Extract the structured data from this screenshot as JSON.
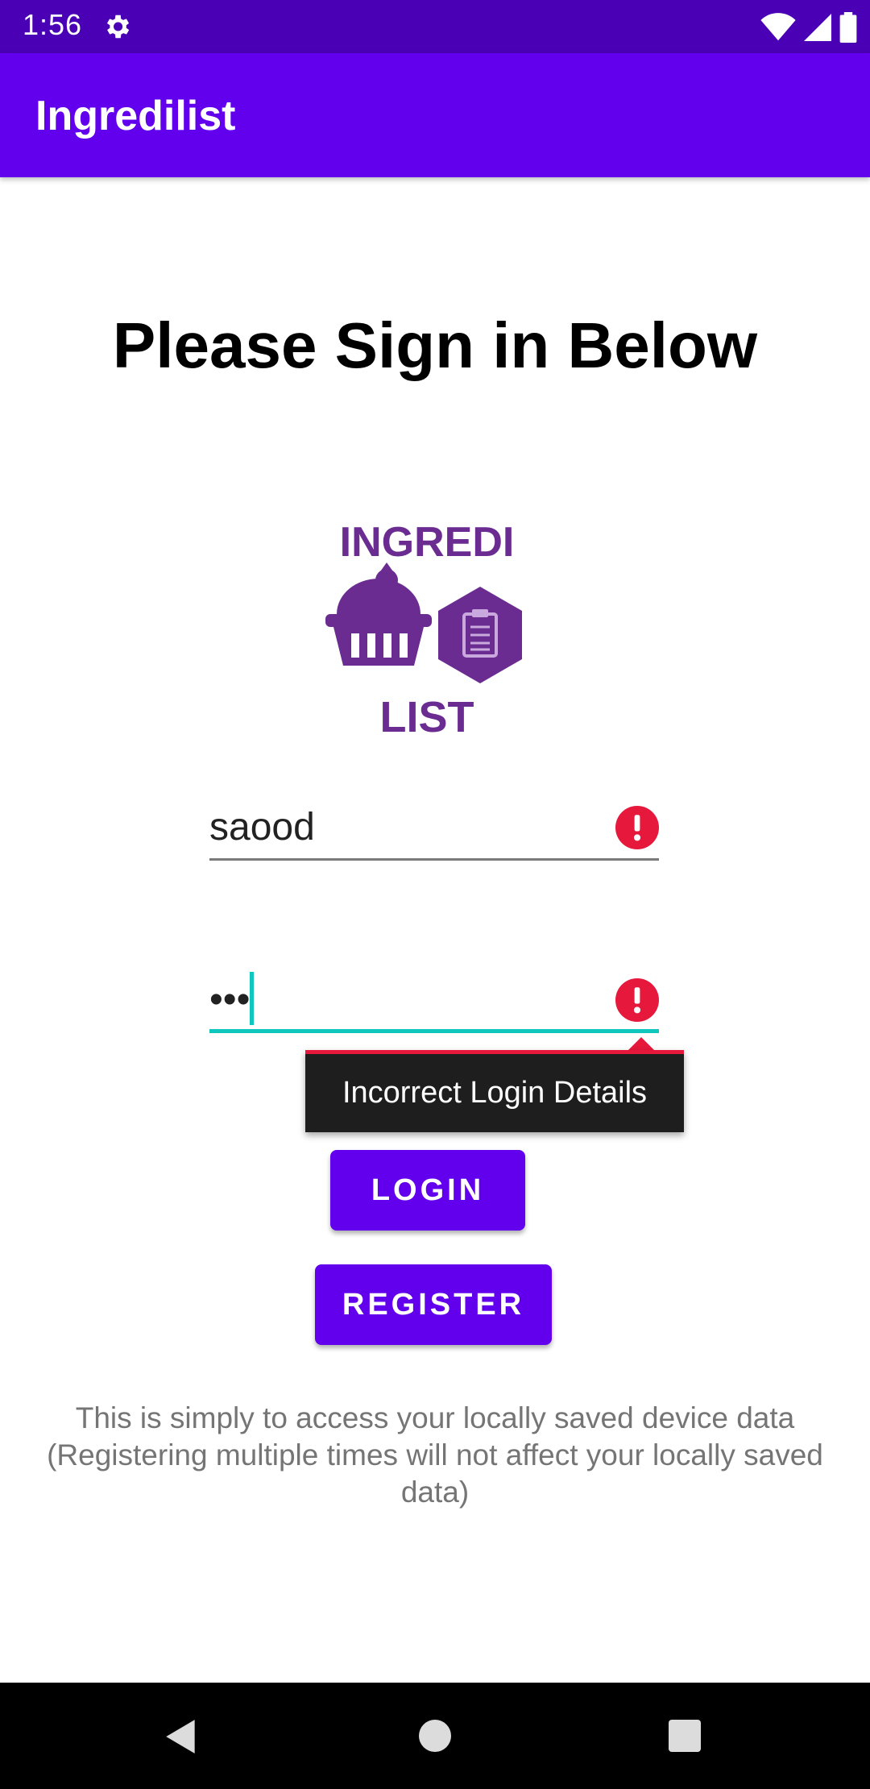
{
  "status_bar": {
    "time": "1:56",
    "background": "#4a00b5"
  },
  "app_bar": {
    "title": "Ingredilist",
    "color": "#6200ee"
  },
  "headline": "Please Sign in Below",
  "logo": {
    "top_text": "INGREDI",
    "bottom_text": "LIST",
    "color": "#6b2c91"
  },
  "username": {
    "value": "saood",
    "error_icon": "error-icon"
  },
  "password": {
    "value": "•••",
    "error_icon": "error-icon"
  },
  "error_tooltip": "Incorrect Login Details",
  "buttons": {
    "login": "LOGIN",
    "register": "REGISTER"
  },
  "info": "This is simply to access your locally saved device data (Registering multiple times will not affect your locally saved data)",
  "colors": {
    "error": "#e6193c",
    "focus": "#10c7bd"
  }
}
